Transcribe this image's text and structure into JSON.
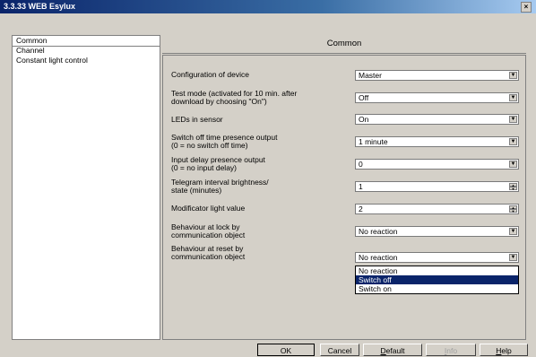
{
  "window": {
    "title": "3.3.33 WEB Esylux",
    "close_glyph": "×"
  },
  "sidebar": {
    "items": [
      {
        "label": "Common"
      },
      {
        "label": "Channel"
      },
      {
        "label": "Constant light control"
      }
    ]
  },
  "main": {
    "header": "Common",
    "params": [
      {
        "label": "Configuration of device",
        "value": "Master",
        "control": "dropdown"
      },
      {
        "label": "Test mode (activated for 10 min. after\ndownload by choosing \"On\")",
        "value": "Off",
        "control": "dropdown"
      },
      {
        "label": "LEDs in sensor",
        "value": "On",
        "control": "dropdown"
      },
      {
        "label": "Switch off time presence output\n  (0 = no switch off time)",
        "value": "1 minute",
        "control": "dropdown"
      },
      {
        "label": "Input delay presence output\n  (0 = no input delay)",
        "value": "0",
        "control": "dropdown"
      },
      {
        "label": "Telegram interval brightness/\nstate (minutes)",
        "value": "1",
        "control": "spinner"
      },
      {
        "label": "Modificator light value",
        "value": "2",
        "control": "spinner"
      },
      {
        "label": "Behaviour at lock by\ncommunication object",
        "value": "No reaction",
        "control": "dropdown"
      },
      {
        "label": "Behaviour at reset by\ncommunication object",
        "value": "No reaction",
        "control": "dropdown"
      }
    ],
    "open_dropdown": {
      "options": [
        "No reaction",
        "Switch off",
        "Switch on"
      ],
      "highlighted": "Switch off"
    }
  },
  "buttons": {
    "ok": "OK",
    "cancel": "Cancel",
    "default_pre": "",
    "default_ul": "D",
    "default_post": "efault",
    "info_pre": "",
    "info_ul": "I",
    "info_post": "nfo",
    "help_pre": "",
    "help_ul": "H",
    "help_post": "elp"
  },
  "colors": {
    "titlebar_start": "#0a246a",
    "titlebar_end": "#a6caf0",
    "highlight": "#0a246a",
    "face": "#d4d0c8"
  }
}
